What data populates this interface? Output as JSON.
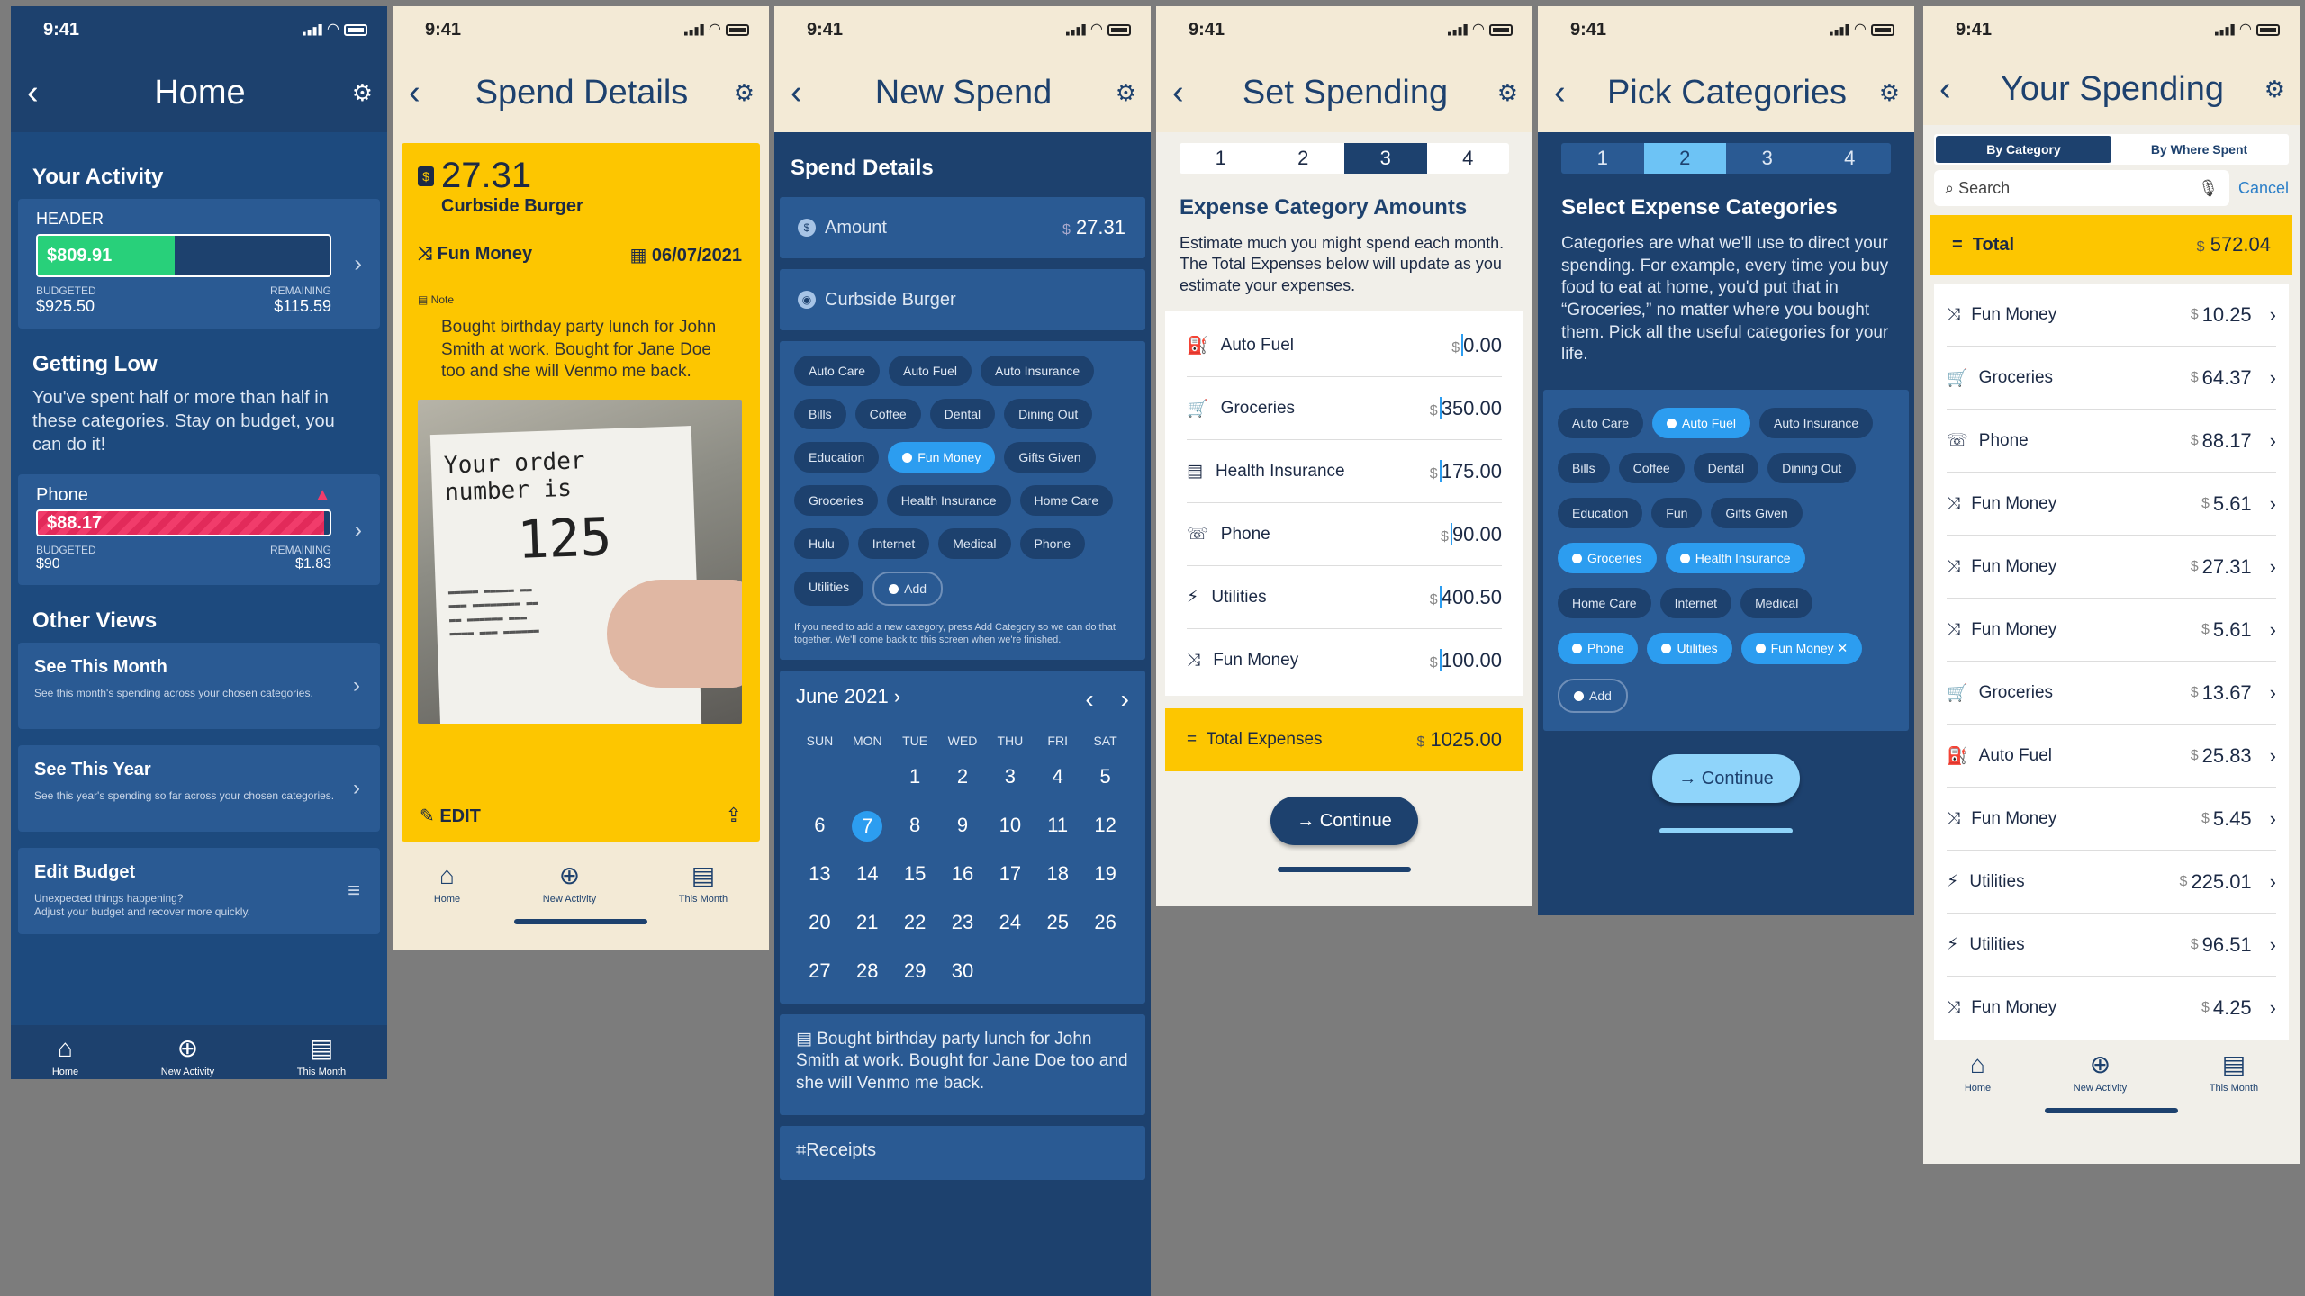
{
  "status_time": "9:41",
  "colors": {
    "navy": "#1d416e",
    "blue_card": "#2a5a93",
    "yellow": "#fdc600",
    "green": "#28d07a",
    "red": "#f13c6b",
    "accent": "#2c9df0"
  },
  "tabs": {
    "home": "Home",
    "new_activity": "New Activity",
    "this_month": "This Month"
  },
  "screen1": {
    "title": "Home",
    "activity_title": "Your Activity",
    "header_label": "HEADER",
    "header_amount": "$809.91",
    "header_fill_fraction": 0.47,
    "budgeted_label": "BUDGETED",
    "budgeted_value": "$925.50",
    "remaining_label": "REMAINING",
    "remaining_value": "$115.59",
    "getting_low_title": "Getting Low",
    "getting_low_text": "You've spent half or more than half in these categories. Stay on budget, you can do it!",
    "phone_label": "Phone",
    "phone_amount": "$88.17",
    "phone_fill_fraction": 0.98,
    "phone_budgeted": "$90",
    "phone_remaining": "$1.83",
    "other_views_title": "Other Views",
    "views": [
      {
        "title": "See This Month",
        "desc": "See this month's spending across your chosen categories."
      },
      {
        "title": "See This Year",
        "desc": "See this year's spending so far across your chosen categories."
      },
      {
        "title": "Edit Budget",
        "desc": "Unexpected things happening?\nAdjust your budget and recover more quickly."
      }
    ]
  },
  "screen2": {
    "title": "Spend Details",
    "amount": "27.31",
    "merchant": "Curbside Burger",
    "category": "Fun Money",
    "date": "06/07/2021",
    "note_label": "Note",
    "note_text": "Bought birthday party lunch for John Smith at work. Bought for Jane Doe too and she will Venmo me back.",
    "receipt_line1": "Your order number is",
    "receipt_number": "125",
    "edit_label": "EDIT"
  },
  "screen3": {
    "title": "New Spend",
    "section_title": "Spend Details",
    "amount_label": "Amount",
    "amount_currency": "$",
    "amount_value": "27.31",
    "merchant_value": "Curbside Burger",
    "chips": [
      "Auto Care",
      "Auto Fuel",
      "Auto Insurance",
      "Bills",
      "Coffee",
      "Dental",
      "Dining Out",
      "Education",
      "Fun Money",
      "Gifts Given",
      "Groceries",
      "Health Insurance",
      "Home Care",
      "Hulu",
      "Internet",
      "Medical",
      "Phone",
      "Utilities"
    ],
    "selected_chips": [
      "Fun Money"
    ],
    "add_label": "Add",
    "hint": "If you need to add a new category, press Add Category so we can do that together. We'll come back to this screen when we're finished.",
    "calendar_month": "June 2021",
    "weekdays": [
      "SUN",
      "MON",
      "TUE",
      "WED",
      "THU",
      "FRI",
      "SAT"
    ],
    "days": [
      "",
      "",
      "1",
      "2",
      "3",
      "4",
      "5",
      "6",
      "7",
      "8",
      "9",
      "10",
      "11",
      "12",
      "13",
      "14",
      "15",
      "16",
      "17",
      "18",
      "19",
      "20",
      "21",
      "22",
      "23",
      "24",
      "25",
      "26",
      "27",
      "28",
      "29",
      "30"
    ],
    "selected_day": "7",
    "note_text": "Bought birthday party lunch for John Smith at work. Bought for Jane Doe too and she will Venmo me back.",
    "receipts_label": "Receipts"
  },
  "screen4": {
    "title": "Set Spending",
    "steps": [
      "1",
      "2",
      "3",
      "4"
    ],
    "active_step": 3,
    "heading": "Expense Category Amounts",
    "description": "Estimate much you might spend each month. The Total Expenses below will update as you estimate your expenses.",
    "currency": "$",
    "rows": [
      {
        "icon": "fuel-icon",
        "glyph": "⛽",
        "label": "Auto Fuel",
        "value": "0.00"
      },
      {
        "icon": "cart-icon",
        "glyph": "🛒",
        "label": "Groceries",
        "value": "350.00"
      },
      {
        "icon": "insurance-icon",
        "glyph": "▤",
        "label": "Health Insurance",
        "value": "175.00"
      },
      {
        "icon": "phone-icon",
        "glyph": "☏",
        "label": "Phone",
        "value": "90.00"
      },
      {
        "icon": "utilities-icon",
        "glyph": "⚡",
        "label": "Utilities",
        "value": "400.50"
      },
      {
        "icon": "shuffle-icon",
        "glyph": "⤨",
        "label": "Fun Money",
        "value": "100.00"
      }
    ],
    "total_label": "Total Expenses",
    "total_value": "1025.00",
    "continue_label": "Continue"
  },
  "screen5": {
    "title": "Pick Categories",
    "steps": [
      "1",
      "2",
      "3",
      "4"
    ],
    "active_step": 2,
    "heading": "Select Expense Categories",
    "description": "Categories are what we'll use to direct your spending. For example, every time you buy food to eat at home, you'd put that in “Groceries,” no matter where you bought them. Pick all the useful categories for your life.",
    "chips": [
      "Auto Care",
      "Auto Fuel",
      "Auto Insurance",
      "Bills",
      "Coffee",
      "Dental",
      "Dining Out",
      "Education",
      "Fun",
      "Gifts Given",
      "Groceries",
      "Health Insurance",
      "Home Care",
      "Internet",
      "Medical",
      "Phone",
      "Utilities",
      "Fun Money"
    ],
    "selected_chips": [
      "Auto Fuel",
      "Groceries",
      "Health Insurance",
      "Phone",
      "Utilities",
      "Fun Money"
    ],
    "add_label": "Add",
    "continue_label": "Continue"
  },
  "screen6": {
    "title": "Your Spending",
    "seg_by_category": "By Category",
    "seg_by_where": "By Where Spent",
    "search_placeholder": "Search",
    "cancel_label": "Cancel",
    "total_label": "Total",
    "total_value": "572.04",
    "currency": "$",
    "rows": [
      {
        "icon": "shuffle-icon",
        "glyph": "⤨",
        "label": "Fun Money",
        "value": "10.25"
      },
      {
        "icon": "cart-icon",
        "glyph": "🛒",
        "label": "Groceries",
        "value": "64.37"
      },
      {
        "icon": "phone-icon",
        "glyph": "☏",
        "label": "Phone",
        "value": "88.17"
      },
      {
        "icon": "shuffle-icon",
        "glyph": "⤨",
        "label": "Fun Money",
        "value": "5.61"
      },
      {
        "icon": "shuffle-icon",
        "glyph": "⤨",
        "label": "Fun Money",
        "value": "27.31"
      },
      {
        "icon": "shuffle-icon",
        "glyph": "⤨",
        "label": "Fun Money",
        "value": "5.61"
      },
      {
        "icon": "cart-icon",
        "glyph": "🛒",
        "label": "Groceries",
        "value": "13.67"
      },
      {
        "icon": "fuel-icon",
        "glyph": "⛽",
        "label": "Auto Fuel",
        "value": "25.83"
      },
      {
        "icon": "shuffle-icon",
        "glyph": "⤨",
        "label": "Fun Money",
        "value": "5.45"
      },
      {
        "icon": "utilities-icon",
        "glyph": "⚡",
        "label": "Utilities",
        "value": "225.01"
      },
      {
        "icon": "utilities-icon",
        "glyph": "⚡",
        "label": "Utilities",
        "value": "96.51"
      },
      {
        "icon": "shuffle-icon",
        "glyph": "⤨",
        "label": "Fun Money",
        "value": "4.25"
      }
    ]
  }
}
